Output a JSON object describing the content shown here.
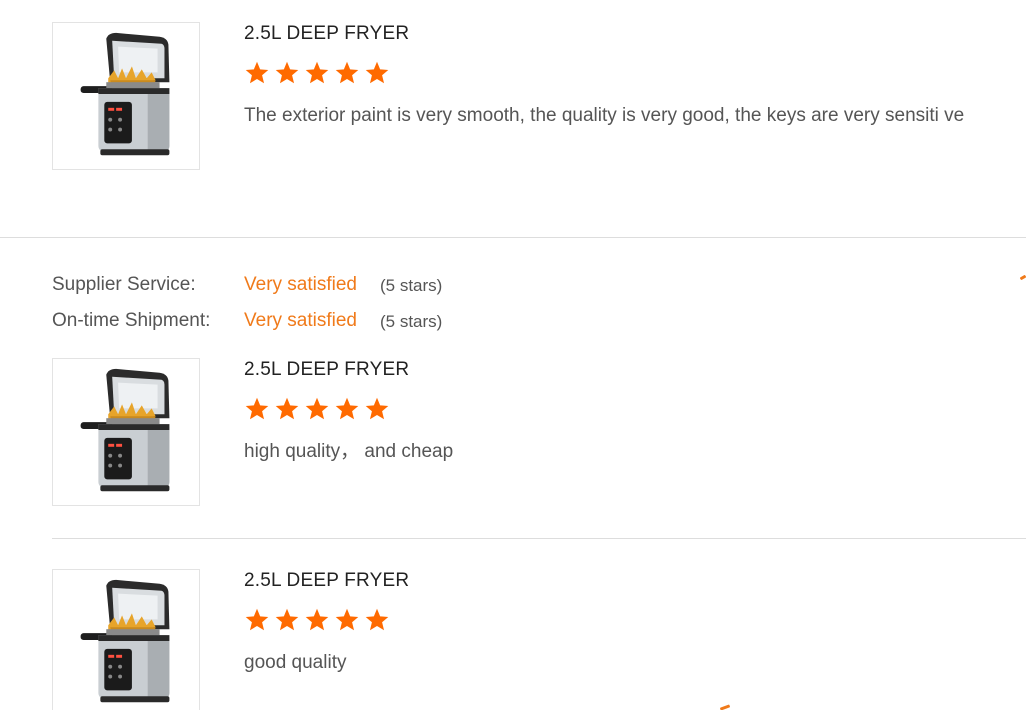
{
  "reviews": [
    {
      "product_title": "2.5L DEEP FRYER",
      "rating": 5,
      "comment": "The exterior paint is very smooth, the quality is very good, the keys are very sensiti ve"
    },
    {
      "product_title": "2.5L DEEP FRYER",
      "rating": 5,
      "comment": "high quality， and cheap"
    },
    {
      "product_title": "2.5L DEEP FRYER",
      "rating": 5,
      "comment": "good quality"
    }
  ],
  "supplier_ratings": [
    {
      "label": "Supplier Service:",
      "value": "Very satisfied",
      "count": "(5 stars)"
    },
    {
      "label": "On-time Shipment:",
      "value": "Very satisfied",
      "count": "(5 stars)"
    }
  ],
  "colors": {
    "star": "#ff6a00",
    "accent_text": "#f07a1a",
    "divider": "#dddddd"
  },
  "icons": {
    "product_image": "deep-fryer-icon",
    "star": "star-icon"
  }
}
